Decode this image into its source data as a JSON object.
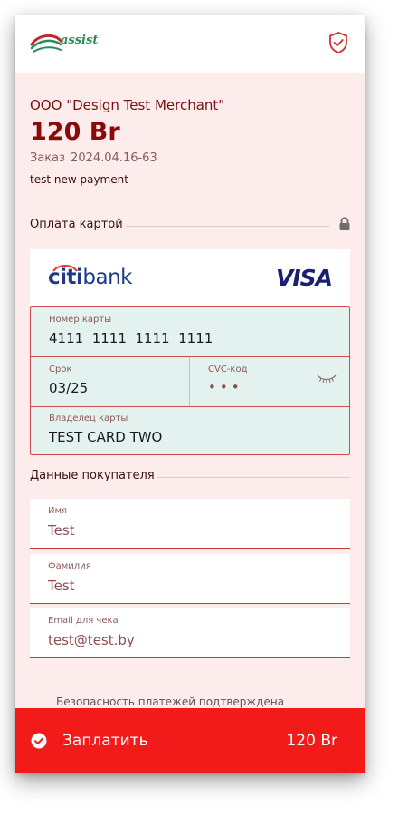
{
  "header": {
    "logo_text": "assist",
    "logo_icon": "assist-logo-icon",
    "security_icon": "shield-check-icon"
  },
  "order": {
    "merchant": "ООО \"Design Test Merchant\"",
    "amount": "120 Br",
    "order_label": "Заказ",
    "order_number": "2024.04.16-63",
    "description": "test new payment"
  },
  "card_section": {
    "title": "Оплата картой",
    "lock_icon": "lock-icon",
    "bank_name_prefix": "citi",
    "bank_name_suffix": "bank",
    "network": "VISA",
    "card_number_label": "Номер карты",
    "card_number": "4111  1111  1111  1111",
    "expiry_label": "Срок",
    "expiry": "03/25",
    "cvc_label": "CVC-код",
    "cvc_mask": "•••",
    "cvc_toggle_icon": "eye-closed-icon",
    "holder_label": "Владелец карты",
    "holder": "TEST CARD TWO"
  },
  "buyer_section": {
    "title": "Данные покупателя",
    "fields": [
      {
        "label": "Имя",
        "value": "Test"
      },
      {
        "label": "Фамилия",
        "value": "Test"
      },
      {
        "label": "Email для чека",
        "value": "test@test.by"
      }
    ]
  },
  "footer": {
    "security_text": "Безопасность платежей подтверждена",
    "pay_label": "Заплатить",
    "pay_amount": "120 Br",
    "pay_icon": "check-circle-icon"
  },
  "colors": {
    "accent": "#f31a1a",
    "page_bg": "#fdecec",
    "field_bg": "#e3f2ee",
    "field_border": "#d14b4b",
    "title": "#8a0a0a"
  }
}
